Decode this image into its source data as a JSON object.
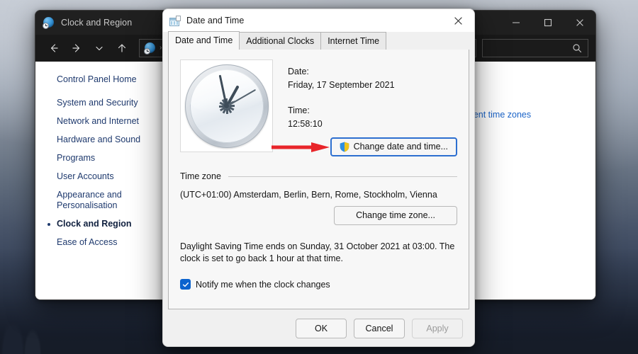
{
  "desktop": {
    "name": "desktop-wallpaper"
  },
  "control_panel_window": {
    "title": "Clock and Region",
    "title_icon": "clock-globe-icon",
    "window_buttons": {
      "minimize": "minimize-icon",
      "maximize": "maximize-icon",
      "close": "close-icon"
    },
    "toolbar": {
      "back": "back-arrow-icon",
      "forward": "forward-arrow-icon",
      "recent": "chevron-down-icon",
      "up": "up-arrow-icon",
      "address_icon": "clock-globe-icon",
      "address_chevron": "›",
      "search_icon": "search-icon"
    },
    "sidebar": {
      "items": [
        {
          "label": "Control Panel Home",
          "current": false
        },
        {
          "label": "System and Security",
          "current": false
        },
        {
          "label": "Network and Internet",
          "current": false
        },
        {
          "label": "Hardware and Sound",
          "current": false
        },
        {
          "label": "Programs",
          "current": false
        },
        {
          "label": "User Accounts",
          "current": false
        },
        {
          "label": "Appearance and Personalisation",
          "current": false
        },
        {
          "label": "Clock and Region",
          "current": true
        },
        {
          "label": "Ease of Access",
          "current": false
        }
      ]
    },
    "content": {
      "partial_link": "fferent time zones"
    }
  },
  "dialog": {
    "title": "Date and Time",
    "title_icon": "date-time-icon",
    "close_icon": "close-icon",
    "tabs": [
      {
        "label": "Date and Time",
        "active": true
      },
      {
        "label": "Additional Clocks",
        "active": false
      },
      {
        "label": "Internet Time",
        "active": false
      }
    ],
    "clock": {
      "name": "analog-clock",
      "hour_angle": 389,
      "minute_angle": 348,
      "second_angle": 60
    },
    "date_label": "Date:",
    "date_value": "Friday, 17 September 2021",
    "time_label": "Time:",
    "time_value": "12:58:10",
    "change_datetime_button": {
      "label": "Change date and time...",
      "shield_icon": "uac-shield-icon",
      "focused": true
    },
    "annotation_arrow": "red-arrow-annotation",
    "timezone_group_label": "Time zone",
    "timezone_value": "(UTC+01:00) Amsterdam, Berlin, Bern, Rome, Stockholm, Vienna",
    "change_timezone_button": "Change time zone...",
    "dst_notice": "Daylight Saving Time ends on Sunday, 31 October 2021 at 03:00. The clock is set to go back 1 hour at that time.",
    "notify_checkbox": {
      "label": "Notify me when the clock changes",
      "checked": true
    },
    "footer": {
      "ok": "OK",
      "cancel": "Cancel",
      "apply": "Apply",
      "apply_disabled": true
    }
  },
  "colors": {
    "accent_blue": "#0b63ce",
    "focus_blue": "#2d6fd0",
    "link_blue": "#1f3a6e",
    "content_link_blue": "#1b64c8",
    "annotation_red": "#e8252a",
    "dialog_bg": "#f0f0f0",
    "panel_bg": "#f7f7f7",
    "titlebar_dark": "#202020"
  }
}
